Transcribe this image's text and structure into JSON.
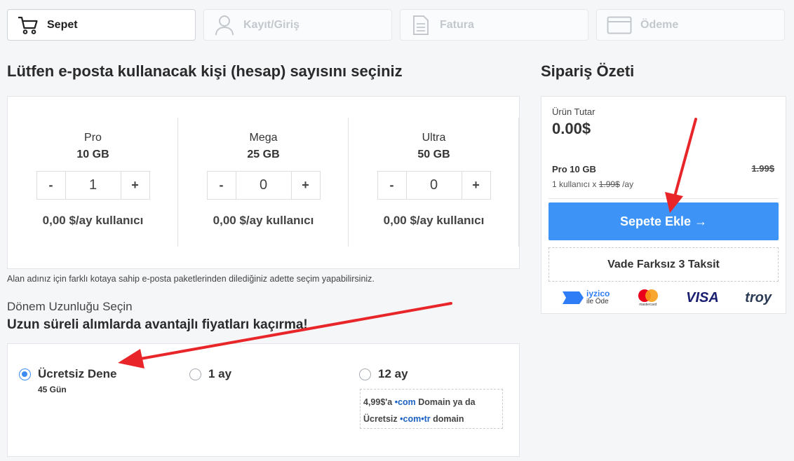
{
  "steps": [
    {
      "label": "Sepet",
      "icon": "cart-icon",
      "active": true
    },
    {
      "label": "Kayıt/Giriş",
      "icon": "user-icon",
      "active": false
    },
    {
      "label": "Fatura",
      "icon": "document-icon",
      "active": false
    },
    {
      "label": "Ödeme",
      "icon": "card-icon",
      "active": false
    }
  ],
  "main": {
    "title": "Lütfen e-posta kullanacak kişi (hesap) sayısını seçiniz",
    "plans": [
      {
        "name": "Pro",
        "size": "10 GB",
        "qty": "1",
        "price": "0,00 $/ay kullanıcı"
      },
      {
        "name": "Mega",
        "size": "25 GB",
        "qty": "0",
        "price": "0,00 $/ay kullanıcı"
      },
      {
        "name": "Ultra",
        "size": "50 GB",
        "qty": "0",
        "price": "0,00 $/ay kullanıcı"
      }
    ],
    "minus": "-",
    "plus": "+",
    "note": "Alan adınız için farklı kotaya sahip e-posta paketlerinden dilediğiniz adette seçim yapabilirsiniz."
  },
  "period": {
    "subtitle": "Dönem Uzunluğu Seçin",
    "title": "Uzun süreli alımlarda avantajlı fiyatları kaçırma!",
    "options": [
      {
        "label": "Ücretsiz Dene",
        "sub": "45 Gün",
        "selected": true
      },
      {
        "label": "1 ay",
        "sub": "",
        "selected": false
      },
      {
        "label": "12 ay",
        "sub": "",
        "selected": false
      }
    ],
    "promo": {
      "p1": "4,99$'a",
      "d1": "•com",
      "p2": "Domain ya da",
      "p3": "Ücretsiz",
      "d2": "•com•tr",
      "p4": "domain"
    }
  },
  "summary": {
    "title": "Sipariş Özeti",
    "total_label": "Ürün Tutar",
    "total_value": "0.00$",
    "line_name": "Pro 10 GB",
    "line_price": "1.99$",
    "line_detail_prefix": "1 kullanıcı x",
    "line_detail_price": "1.99$",
    "line_detail_suffix": "/ay",
    "add_button": "Sepete Ekle →",
    "taksit": "Vade Farksız 3 Taksit",
    "payments": {
      "iyzico": "iyzico",
      "iyzico_sub": "ile Öde",
      "mastercard": "mastercard",
      "visa": "VISA",
      "troy": "troy"
    }
  },
  "colors": {
    "accent": "#3d94f6",
    "arrow": "#e8262a"
  }
}
